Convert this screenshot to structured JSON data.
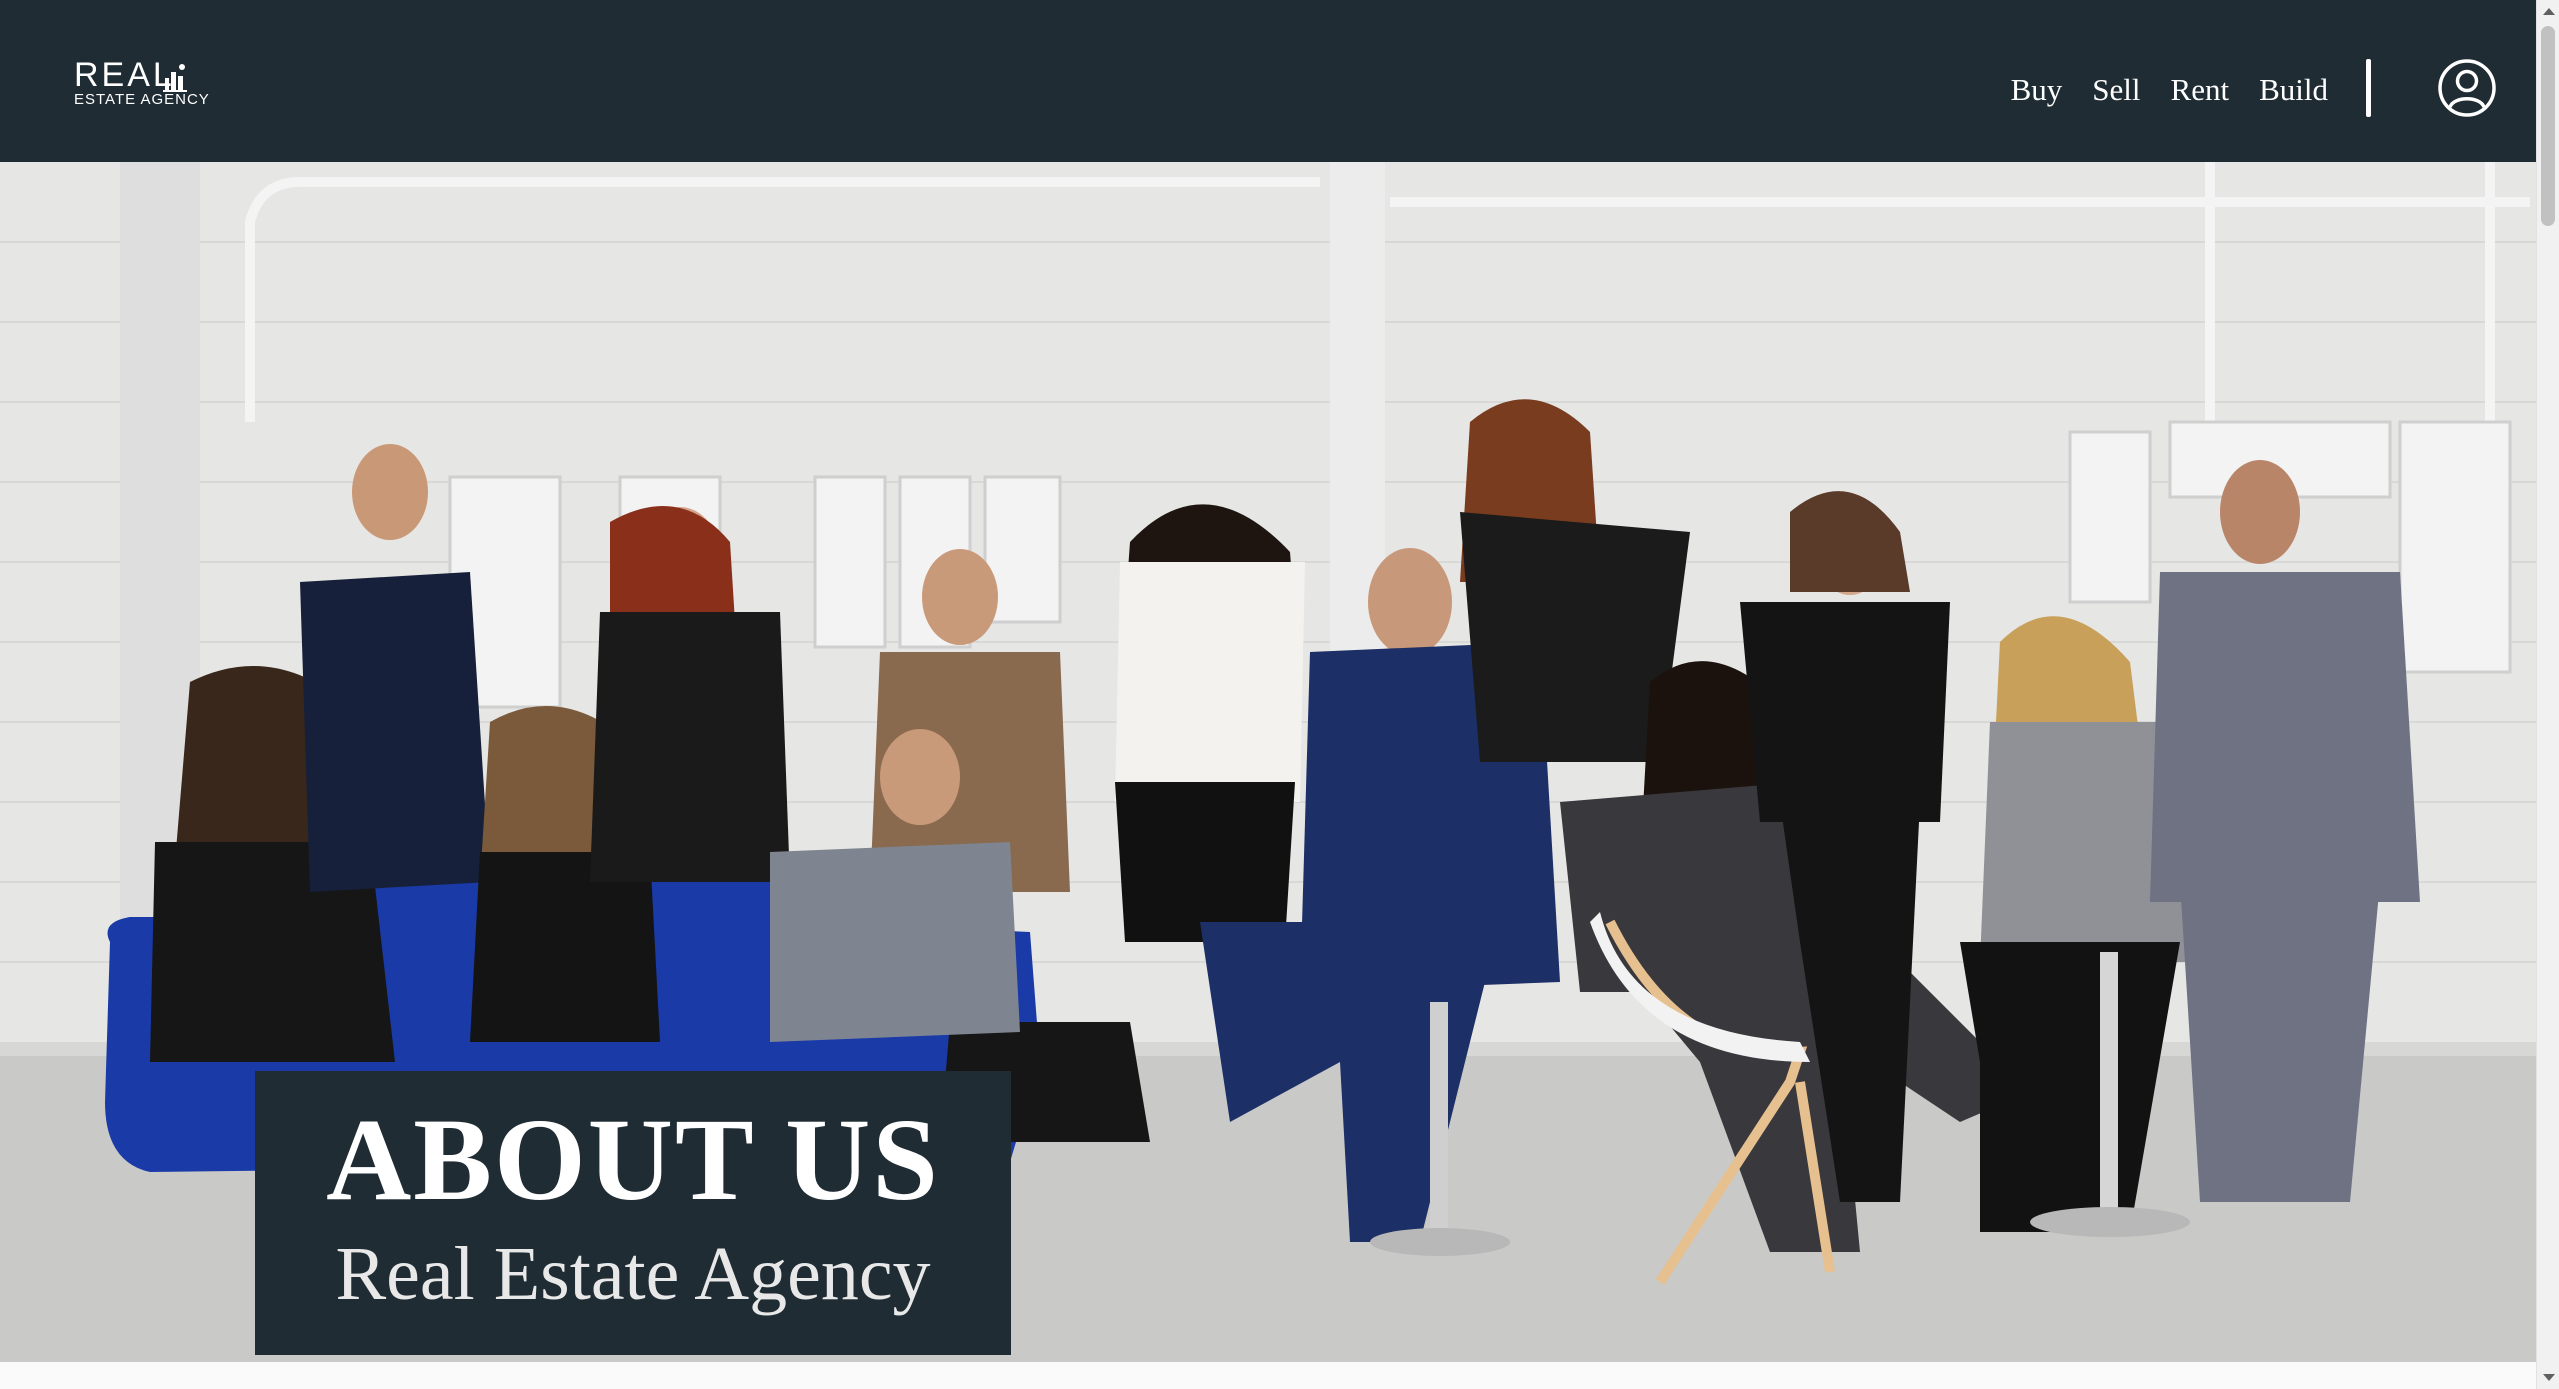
{
  "header": {
    "logo": {
      "line1": "REAL",
      "line2": "ESTATE AGENCY",
      "icon": "building-icon"
    },
    "nav": [
      {
        "label": "Buy"
      },
      {
        "label": "Sell"
      },
      {
        "label": "Rent"
      },
      {
        "label": "Build"
      }
    ],
    "account_icon": "user-circle-icon",
    "background_color": "#1f2c33"
  },
  "hero": {
    "image": "team-group-photo",
    "title": "ABOUT US",
    "subtitle": "Real Estate Agency"
  },
  "colors": {
    "brand_dark": "#1f2c33",
    "text_light": "#ffffff"
  }
}
